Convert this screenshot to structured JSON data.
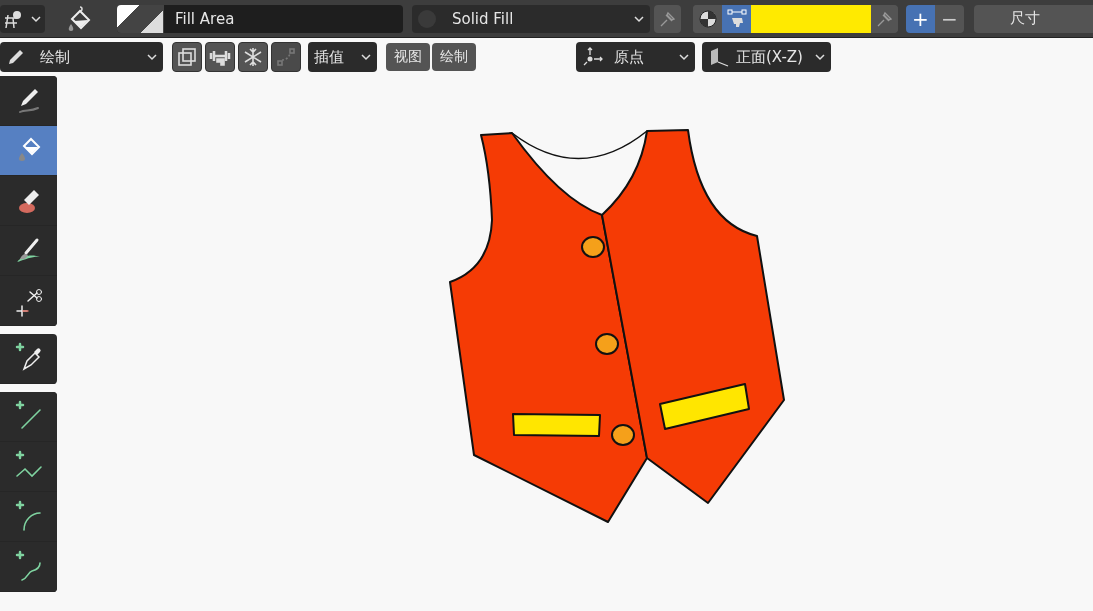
{
  "header": {
    "material": {
      "name": "Fill Area"
    },
    "fill_style": {
      "value": "Solid Fill"
    },
    "color_modes": [
      {
        "kind": "material",
        "selected": false
      },
      {
        "kind": "vertex",
        "selected": true
      }
    ],
    "color_swatch": {
      "color": "#ffea00"
    },
    "blend_buttons": [
      {
        "label": "+",
        "selected": true
      },
      {
        "label": "−",
        "selected": false
      }
    ],
    "size_label": "尺寸"
  },
  "tool_header": {
    "mode": "绘制",
    "toggles": [
      {
        "kind": "layers",
        "disabled": false
      },
      {
        "kind": "weight",
        "disabled": false
      },
      {
        "kind": "freeze",
        "disabled": false
      },
      {
        "kind": "link",
        "disabled": true
      }
    ],
    "interpolate": "插值",
    "menus": [
      "视图",
      "绘制"
    ],
    "pivot": "原点",
    "plane": "正面(X-Z)"
  },
  "toolbar": [
    [
      {
        "kind": "draw",
        "selected": false
      },
      {
        "kind": "fill",
        "selected": true
      },
      {
        "kind": "erase",
        "selected": false
      },
      {
        "kind": "tint",
        "selected": false
      },
      {
        "kind": "cutter",
        "selected": false
      }
    ],
    [
      {
        "kind": "eyedropper",
        "selected": false
      }
    ],
    [
      {
        "kind": "line",
        "selected": false
      },
      {
        "kind": "polyline",
        "selected": false
      },
      {
        "kind": "arc",
        "selected": false
      },
      {
        "kind": "curve",
        "selected": false
      }
    ]
  ]
}
